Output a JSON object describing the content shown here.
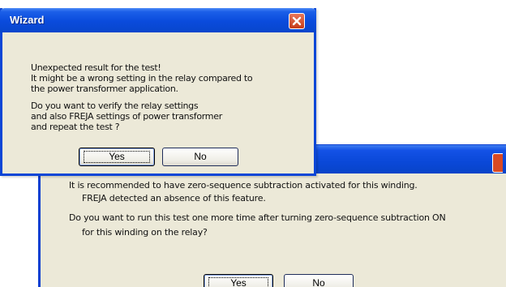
{
  "dialog_back": {
    "lines": [
      "It is recommended to have zero-sequence subtraction activated for this winding.",
      "FREJA detected an absence of this feature.",
      "Do you want to run this test one more time after turning zero-sequence subtraction ON",
      "for this winding on the relay?"
    ],
    "yes_label": "Yes",
    "no_label": "No"
  },
  "dialog_front": {
    "title": "Wizard",
    "lines": [
      "Unexpected result for the test!",
      "It might be a wrong setting in the relay compared to",
      "the power transformer application.",
      "Do you want to verify the relay settings",
      "and also FREJA settings of power transformer",
      "and repeat the test ?"
    ],
    "yes_label": "Yes",
    "no_label": "No"
  },
  "colors": {
    "titlebar_blue": "#0a4bdc",
    "dialog_face": "#ece9d8",
    "close_red": "#d94a24"
  }
}
